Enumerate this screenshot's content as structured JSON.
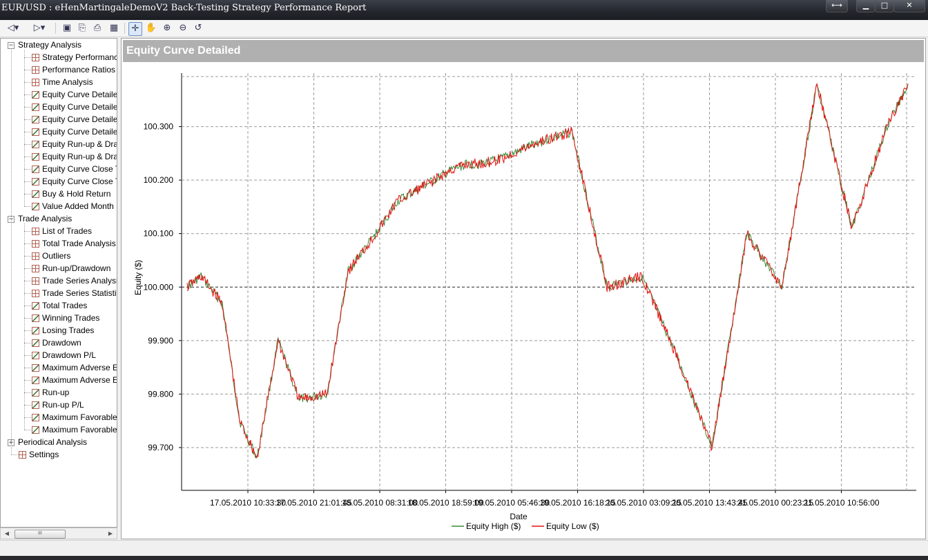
{
  "window": {
    "title": "EUR/USD : eHenMartingaleDemoV2 Back-Testing Strategy Performance Report",
    "buttons": {
      "restore": "⟷",
      "minimize": "▁",
      "maximize": "□",
      "close": "✕"
    }
  },
  "toolbar": {
    "icons": [
      "back-arrow-icon",
      "forward-arrow-icon",
      "save-icon",
      "page-setup-icon",
      "print-icon",
      "table-icon",
      "select-cursor-icon",
      "hand-pan-icon",
      "zoom-in-icon",
      "zoom-out-icon",
      "reset-zoom-icon"
    ]
  },
  "tree": {
    "groups": [
      {
        "label": "Strategy Analysis",
        "expanded": true,
        "items": [
          {
            "label": "Strategy Performanc",
            "icon": "grid"
          },
          {
            "label": "Performance Ratios",
            "icon": "grid"
          },
          {
            "label": "Time Analysis",
            "icon": "grid"
          },
          {
            "label": "Equity Curve Detaile",
            "icon": "chart"
          },
          {
            "label": "Equity Curve Detaile",
            "icon": "chart"
          },
          {
            "label": "Equity Curve Detaile",
            "icon": "chart"
          },
          {
            "label": "Equity Curve Detaile",
            "icon": "chart"
          },
          {
            "label": "Equity Run-up & Dra",
            "icon": "chart"
          },
          {
            "label": "Equity Run-up & Dra",
            "icon": "chart"
          },
          {
            "label": "Equity Curve Close T",
            "icon": "chart"
          },
          {
            "label": "Equity Curve Close T",
            "icon": "chart"
          },
          {
            "label": "Buy & Hold Return",
            "icon": "chart"
          },
          {
            "label": "Value Added Month",
            "icon": "chart"
          }
        ]
      },
      {
        "label": "Trade Analysis",
        "expanded": true,
        "items": [
          {
            "label": "List of Trades",
            "icon": "grid"
          },
          {
            "label": "Total Trade Analysis",
            "icon": "grid"
          },
          {
            "label": "Outliers",
            "icon": "grid"
          },
          {
            "label": "Run-up/Drawdown",
            "icon": "grid"
          },
          {
            "label": "Trade Series Analysis",
            "icon": "grid"
          },
          {
            "label": "Trade Series Statistic",
            "icon": "grid"
          },
          {
            "label": "Total Trades",
            "icon": "chart"
          },
          {
            "label": "Winning Trades",
            "icon": "chart"
          },
          {
            "label": "Losing Trades",
            "icon": "chart"
          },
          {
            "label": "Drawdown",
            "icon": "chart"
          },
          {
            "label": "Drawdown P/L",
            "icon": "chart"
          },
          {
            "label": "Maximum Adverse E",
            "icon": "chart"
          },
          {
            "label": "Maximum Adverse E",
            "icon": "chart"
          },
          {
            "label": "Run-up",
            "icon": "chart"
          },
          {
            "label": "Run-up P/L",
            "icon": "chart"
          },
          {
            "label": "Maximum Favorable",
            "icon": "chart"
          },
          {
            "label": "Maximum Favorable",
            "icon": "chart"
          }
        ]
      },
      {
        "label": "Periodical Analysis",
        "expanded": false,
        "items": []
      }
    ],
    "settings": {
      "label": "Settings",
      "icon": "grid"
    },
    "scrollbar": {
      "left": "◀",
      "right": "▶",
      "grip": "III"
    }
  },
  "main": {
    "header": "Equity Curve Detailed"
  },
  "chart_data": {
    "type": "line",
    "title": "",
    "xlabel": "Date",
    "ylabel": "Equity ($)",
    "x_tick_labels": [
      "17.05.2010 10:33:30",
      "17.05.2010 21:01:45",
      "18.05.2010 08:31:00",
      "18.05.2010 18:59:00",
      "19.05.2010 05:46:30",
      "19.05.2010 16:18:15",
      "20.05.2010 03:09:15",
      "20.05.2010 13:43:45",
      "21.05.2010 00:23:15",
      "21.05.2010 10:56:00"
    ],
    "x": [
      0,
      0.2,
      0.5,
      0.75,
      1,
      1.3,
      1.6,
      2,
      2.3,
      2.7,
      3,
      3.4,
      3.8,
      4,
      4.2,
      4.5,
      5,
      5.5,
      6,
      6.5,
      7,
      7.5,
      8,
      8.5,
      9,
      9.5,
      10,
      10.3
    ],
    "y_ticks": [
      99.7,
      99.8,
      99.9,
      100.0,
      100.1,
      100.2,
      100.3
    ],
    "ylim": [
      99.62,
      100.4
    ],
    "grid": true,
    "legend_position": "bottom",
    "series": [
      {
        "name": "Equity High ($)",
        "color": "#3a8a3a",
        "values": [
          100.0,
          100.02,
          99.97,
          99.75,
          99.68,
          99.9,
          99.79,
          99.8,
          100.03,
          100.1,
          100.16,
          100.19,
          100.22,
          100.23,
          100.23,
          100.24,
          100.27,
          100.29,
          100.0,
          100.02,
          99.87,
          99.7,
          100.1,
          100.0,
          100.38,
          100.11,
          100.3,
          100.38
        ]
      },
      {
        "name": "Equity Low ($)",
        "color": "#e81010",
        "values": [
          100.0,
          100.02,
          99.97,
          99.75,
          99.68,
          99.9,
          99.79,
          99.8,
          100.03,
          100.1,
          100.16,
          100.19,
          100.22,
          100.23,
          100.23,
          100.24,
          100.27,
          100.29,
          100.0,
          100.02,
          99.87,
          99.7,
          100.1,
          100.0,
          100.38,
          100.11,
          100.3,
          100.38
        ]
      }
    ]
  }
}
